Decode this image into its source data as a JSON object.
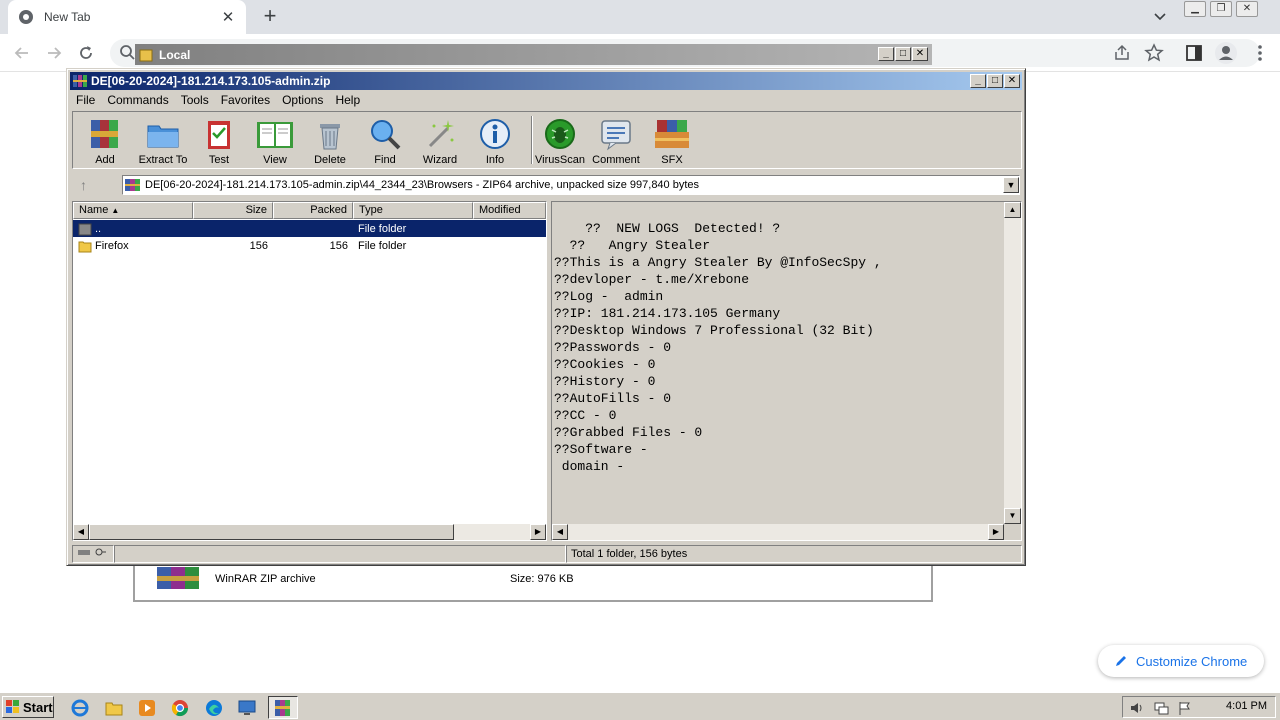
{
  "browser": {
    "tab_title": "New Tab",
    "customize_label": "Customize Chrome"
  },
  "local_window": {
    "title": "Local",
    "archive_type": "WinRAR ZIP archive",
    "size_text": "Size: 976 KB"
  },
  "winrar": {
    "title": "DE[06-20-2024]-181.214.173.105-admin.zip",
    "menu": [
      "File",
      "Commands",
      "Tools",
      "Favorites",
      "Options",
      "Help"
    ],
    "toolbar": [
      {
        "label": "Add",
        "icon": "add-archive-icon"
      },
      {
        "label": "Extract To",
        "icon": "extract-folder-icon"
      },
      {
        "label": "Test",
        "icon": "test-clipboard-icon"
      },
      {
        "label": "View",
        "icon": "view-book-icon"
      },
      {
        "label": "Delete",
        "icon": "trash-icon"
      },
      {
        "label": "Find",
        "icon": "magnifier-icon"
      },
      {
        "label": "Wizard",
        "icon": "wand-icon"
      },
      {
        "label": "Info",
        "icon": "info-icon"
      },
      {
        "label": "VirusScan",
        "icon": "bug-icon"
      },
      {
        "label": "Comment",
        "icon": "comment-icon"
      },
      {
        "label": "SFX",
        "icon": "sfx-books-icon"
      }
    ],
    "path": "DE[06-20-2024]-181.214.173.105-admin.zip\\44_2344_23\\Browsers - ZIP64 archive, unpacked size 997,840 bytes",
    "columns": [
      "Name",
      "Size",
      "Packed",
      "Type",
      "Modified"
    ],
    "rows": [
      {
        "name": "..",
        "size": "",
        "packed": "",
        "type": "File folder",
        "selected": true
      },
      {
        "name": "Firefox",
        "size": "156",
        "packed": "156",
        "type": "File folder",
        "selected": false
      }
    ],
    "comment": "    ??  NEW LOGS  Detected! ?\n  ??   Angry Stealer\n??This is a Angry Stealer By @InfoSecSpy ,\n??devloper - t.me/Xrebone\n??Log -  admin\n??IP: 181.214.173.105 Germany\n??Desktop Windows 7 Professional (32 Bit)\n??Passwords - 0\n??Cookies - 0\n??History - 0\n??AutoFills - 0\n??CC - 0\n??Grabbed Files - 0\n??Software -\n domain -",
    "status_left": "",
    "status_right": "Total 1 folder, 156 bytes"
  },
  "taskbar": {
    "start_label": "Start",
    "clock": "4:01 PM"
  }
}
